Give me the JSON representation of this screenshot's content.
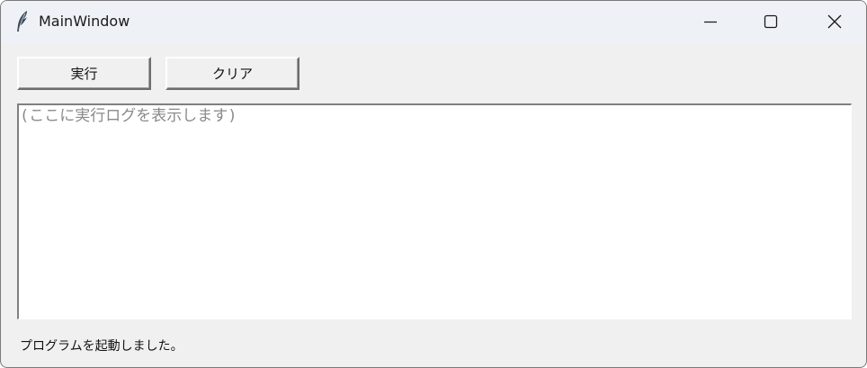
{
  "window": {
    "title": "MainWindow",
    "app_icon": "feather-icon",
    "controls": {
      "minimize_icon": "minimize-icon",
      "maximize_icon": "maximize-icon",
      "close_icon": "close-icon"
    }
  },
  "toolbar": {
    "run_label": "実行",
    "clear_label": "クリア"
  },
  "log": {
    "placeholder": "(ここに実行ログを表示します)"
  },
  "status": {
    "text": "プログラムを起動しました。"
  }
}
